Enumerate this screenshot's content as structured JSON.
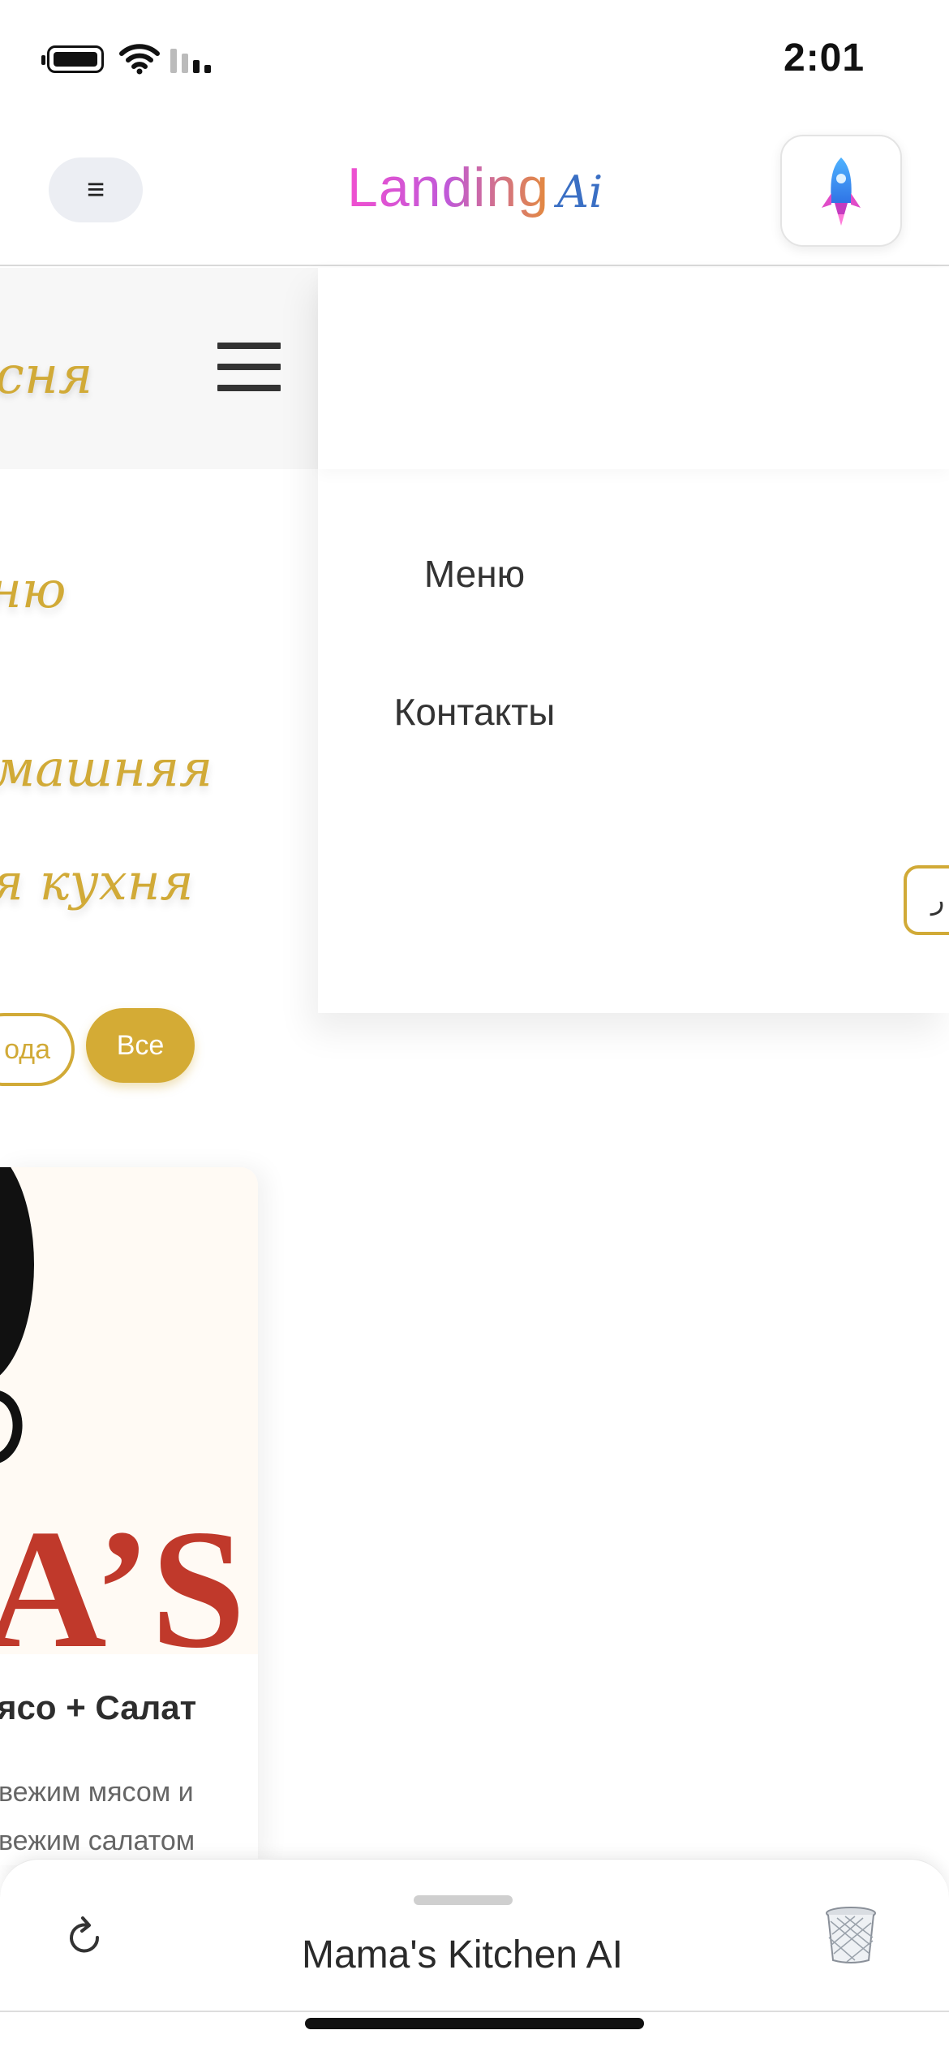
{
  "status_bar": {
    "time": "2:01",
    "icons": [
      "battery-icon",
      "wifi-icon",
      "signal-icon"
    ]
  },
  "header": {
    "menu_label": "≡",
    "logo_main": "Landing",
    "logo_suffix": "Ai",
    "action_icon": "rocket-icon"
  },
  "site": {
    "logo_text": "сня",
    "hero_lines": [
      "ню",
      "машняя",
      "я кухня"
    ],
    "filters": [
      "ода",
      "Все"
    ],
    "product": {
      "image_text": "A’S",
      "title": "ясо + Салат",
      "description_lines": [
        "вежим мясом и",
        "вежим салатом"
      ]
    }
  },
  "dropdown": {
    "links": [
      "Меню",
      "Контакты"
    ],
    "lang_label": "ر"
  },
  "bottom_sheet": {
    "title": "Mama's Kitchen AI",
    "left_icon": "refresh-icon",
    "right_icon": "trash-icon"
  },
  "colors": {
    "gold": "#d1aa37",
    "text": "#2b2b2b"
  }
}
